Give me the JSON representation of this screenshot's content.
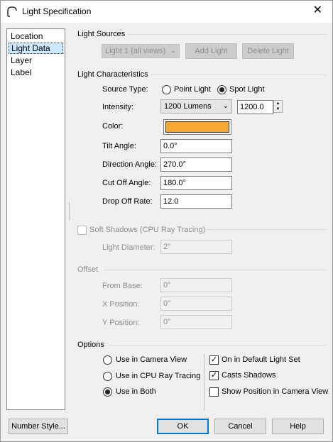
{
  "window": {
    "title": "Light Specification",
    "icon": "arch-app-icon",
    "close_glyph": "✕"
  },
  "nav": {
    "items": [
      "Location",
      "Light Data",
      "Layer",
      "Label"
    ],
    "selected": "Light Data"
  },
  "light_sources": {
    "title": "Light Sources",
    "select_value": "Light 1 (all views)",
    "add_label": "Add Light",
    "delete_label": "Delete Light"
  },
  "light_characteristics": {
    "title": "Light Characteristics",
    "source_type_label": "Source Type:",
    "point_light_label": "Point Light",
    "spot_light_label": "Spot Light",
    "selected_source": "Spot Light",
    "intensity_label": "Intensity:",
    "intensity_select": "1200 Lumens",
    "intensity_value": "1200.0",
    "color_label": "Color:",
    "color_value": "#f7a833",
    "tilt_label": "Tilt Angle:",
    "tilt_value": "0.0°",
    "direction_label": "Direction Angle:",
    "direction_value": "270.0°",
    "cutoff_label": "Cut Off Angle:",
    "cutoff_value": "180.0°",
    "dropoff_label": "Drop Off Rate:",
    "dropoff_value": "12.0"
  },
  "soft_shadows": {
    "label": "Soft Shadows (CPU Ray Tracing)",
    "checked": false,
    "diameter_label": "Light Diameter:",
    "diameter_value": "2\""
  },
  "offset": {
    "title": "Offset",
    "from_base_label": "From Base:",
    "from_base_value": "0\"",
    "x_label": "X Position:",
    "x_value": "0\"",
    "y_label": "Y Position:",
    "y_value": "0\""
  },
  "options": {
    "title": "Options",
    "use_camera_label": "Use in Camera View",
    "use_cpu_label": "Use in CPU Ray Tracing",
    "use_both_label": "Use in Both",
    "selected_use": "Use in Both",
    "default_set_label": "On in Default Light Set",
    "default_set_checked": true,
    "casts_shadows_label": "Casts Shadows",
    "casts_shadows_checked": true,
    "show_position_label": "Show Position in Camera View",
    "show_position_checked": false
  },
  "footer": {
    "number_style_label": "Number Style...",
    "ok_label": "OK",
    "cancel_label": "Cancel",
    "help_label": "Help"
  }
}
